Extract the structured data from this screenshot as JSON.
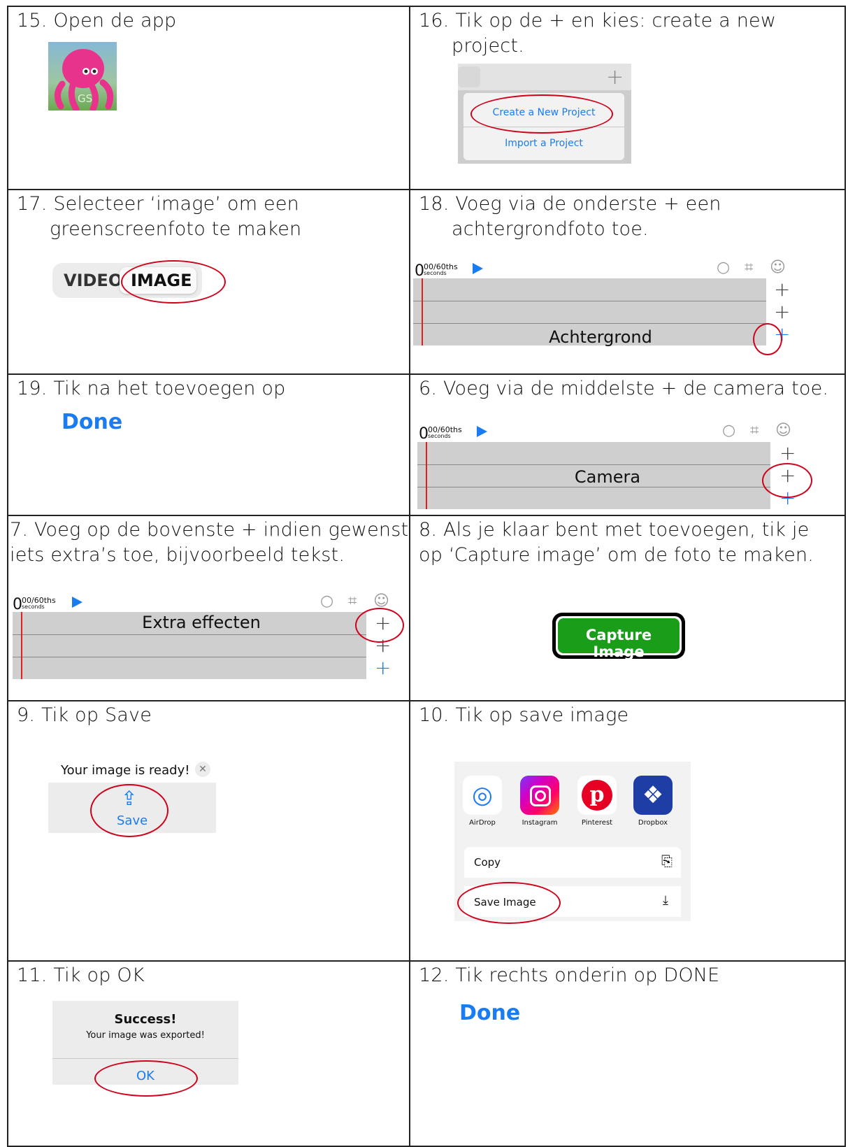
{
  "steps": {
    "s15": {
      "label": "15. Open de app",
      "icon_text": "GS"
    },
    "s16": {
      "line1": "16. Tik op de + en kies: create a new",
      "line2": "project.",
      "menu_create": "Create a New Project",
      "menu_import": "Import a Project"
    },
    "s17": {
      "line1": "17. Selecteer ‘image’ om een",
      "line2": "greenscreenfoto te maken",
      "opt_video": "VIDEO",
      "opt_image": "IMAGE"
    },
    "s18": {
      "line1": "18. Voeg via de onderste + een",
      "line2": "achtergrondfoto toe.",
      "track_label": "Achtergrond"
    },
    "s19": {
      "label": "19. Tik na het toevoegen op",
      "done": "Done"
    },
    "s6": {
      "label": "6. Voeg via de middelste + de camera toe.",
      "track_label": "Camera"
    },
    "s7": {
      "line1": "7. Voeg op de bovenste + indien gewenst",
      "line2": "iets extra’s toe, bijvoorbeeld tekst.",
      "track_label": "Extra effecten"
    },
    "s8": {
      "line1": "8. Als je klaar bent met toevoegen, tik je",
      "line2": "op ‘Capture image’ om de foto te maken.",
      "button": "Capture Image"
    },
    "s9": {
      "label": "9.  Tik op Save",
      "dialog_title": "Your image is ready!",
      "save": "Save"
    },
    "s10": {
      "label": "10. Tik op save image",
      "apps": [
        "AirDrop",
        "Instagram",
        "Pinterest",
        "Dropbox"
      ],
      "copy": "Copy",
      "save_image": "Save Image"
    },
    "s11": {
      "label": "11.  Tik op OK",
      "title": "Success!",
      "message": "Your image was exported!",
      "ok": "OK"
    },
    "s12": {
      "label": "12. Tik rechts onderin op DONE",
      "done": "Done"
    }
  },
  "timeline": {
    "zero": "0",
    "frac": "00/60ths",
    "unit": "seconds"
  },
  "colors": {
    "accent": "#1a7cf2",
    "annotation": "#d0021b",
    "capture_green": "#1a9e1a"
  }
}
